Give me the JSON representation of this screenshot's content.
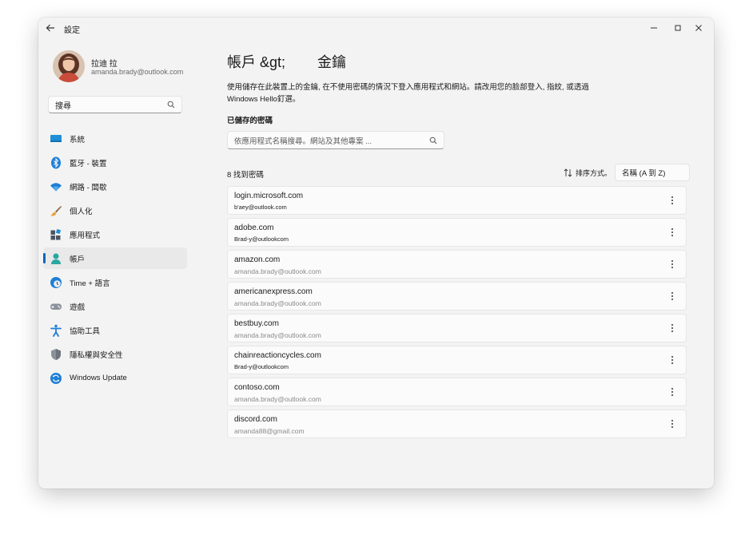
{
  "window": {
    "title": "設定"
  },
  "user": {
    "name": "拉迪 拉",
    "email": "amanda.brady@outlook.com"
  },
  "sidebar": {
    "search_value": "搜尋",
    "items": [
      {
        "label": "系統",
        "icon": "monitor-icon"
      },
      {
        "label": "藍牙 - 裝置",
        "icon": "bluetooth-icon"
      },
      {
        "label": "網路 - 闆歇",
        "icon": "wifi-icon"
      },
      {
        "label": "個人化",
        "icon": "brush-icon"
      },
      {
        "label": "應用程式",
        "icon": "apps-icon"
      },
      {
        "label": "帳戶",
        "icon": "person-icon",
        "selected": true
      },
      {
        "label": "Time + 語言",
        "icon": "globe-clock-icon"
      },
      {
        "label": "遊戲",
        "icon": "gamepad-icon"
      },
      {
        "label": "協助工具",
        "icon": "accessibility-icon"
      },
      {
        "label": "隱私權與安全性",
        "icon": "shield-icon"
      },
      {
        "label": "Windows Update",
        "icon": "update-icon"
      }
    ]
  },
  "main": {
    "title": "帳戶 &gt;        金鑰",
    "description": "使用儲存在此裝置上的金鑰, 在不使用密碼的情況下登入應用程式和網站。請改用您的臉部登入, 指紋, 或透過Windows Hello釘選。",
    "saved_label": "已儲存的密碼",
    "search_placeholder": "依應用程式名稱搜尋。網站及其他專案 ...",
    "found_label": "8 找到密碼",
    "sort_label": "排序方式。",
    "sort_value": "名稱 (A 到 Z)",
    "passwords": [
      {
        "site": "login.microsoft.com",
        "account": "b'aey@outlook.com",
        "dark": true
      },
      {
        "site": "adobe.com",
        "account": "Brad-y@outlookcom",
        "dark": true
      },
      {
        "site": "amazon.com",
        "account": "amanda.brady@outlook.com",
        "dark": false
      },
      {
        "site": "americanexpress.com",
        "account": "amanda.brady@outlook.com",
        "dark": false
      },
      {
        "site": "bestbuy.com",
        "account": "amanda.brady@outlook.com",
        "dark": false
      },
      {
        "site": "chainreactioncycles.com",
        "account": "Brad-y@outlookcom",
        "dark": true
      },
      {
        "site": "contoso.com",
        "account": "amanda.brady@outlook.com",
        "dark": false
      },
      {
        "site": "discord.com",
        "account": "amanda88@gmail.com",
        "dark": false
      }
    ]
  },
  "colors": {
    "accent": "#0067c0",
    "window_bg": "#f3f3f3",
    "card_bg": "#fbfbfb"
  }
}
